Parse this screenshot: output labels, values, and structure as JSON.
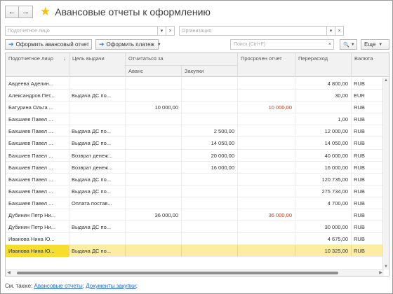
{
  "header": {
    "back": "←",
    "forward": "→",
    "title": "Авансовые отчеты к оформлению"
  },
  "filters": {
    "person_placeholder": "Подотчетное лицо",
    "org_placeholder": "Организация",
    "dd": "▾",
    "clear": "×"
  },
  "toolbar": {
    "create_report": "Оформить авансовый отчет",
    "create_payment": "Оформить платеж",
    "search_placeholder": "Поиск (Ctrl+F)",
    "search_clear": "×",
    "search_icon": "🔍",
    "more": "Еще"
  },
  "table": {
    "headers": {
      "person": "Подотчетное лицо",
      "sort": "↓",
      "purpose": "Цель выдачи",
      "report": "Отчитаться за",
      "advance": "Аванс",
      "purchases": "Закупки",
      "overdue": "Просрочен отчет",
      "overspend": "Перерасход",
      "currency": "Валюта"
    },
    "rows": [
      {
        "person": "Авдеева Аделин...",
        "purpose": "",
        "advance": "",
        "purchases": "",
        "overdue": "",
        "overspend": "4 800,00",
        "currency": "RUB"
      },
      {
        "person": "Александров Пет...",
        "purpose": "Выдача ДС по...",
        "advance": "",
        "purchases": "",
        "overdue": "",
        "overspend": "30,00",
        "currency": "EUR"
      },
      {
        "person": "Батурина Ольга ...",
        "purpose": "",
        "advance": "10 000,00",
        "purchases": "",
        "overdue": "10 000,00",
        "overspend": "",
        "currency": "RUB"
      },
      {
        "person": "Бахшиев Павел ...",
        "purpose": "",
        "advance": "",
        "purchases": "",
        "overdue": "",
        "overspend": "1,00",
        "currency": "RUB"
      },
      {
        "person": "Бахшиев Павел ...",
        "purpose": "Выдача ДС по...",
        "advance": "",
        "purchases": "2 500,00",
        "overdue": "",
        "overspend": "12 000,00",
        "currency": "RUB"
      },
      {
        "person": "Бахшиев Павел ...",
        "purpose": "Выдача ДС по...",
        "advance": "",
        "purchases": "14 050,00",
        "overdue": "",
        "overspend": "14 050,00",
        "currency": "RUB"
      },
      {
        "person": "Бахшиев Павел ...",
        "purpose": "Возврат денеж...",
        "advance": "",
        "purchases": "20 000,00",
        "overdue": "",
        "overspend": "40 000,00",
        "currency": "RUB"
      },
      {
        "person": "Бахшиев Павел ...",
        "purpose": "Возврат денеж...",
        "advance": "",
        "purchases": "16 000,00",
        "overdue": "",
        "overspend": "16 000,00",
        "currency": "RUB"
      },
      {
        "person": "Бахшиев Павел ...",
        "purpose": "Выдача ДС по...",
        "advance": "",
        "purchases": "",
        "overdue": "",
        "overspend": "120 735,00",
        "currency": "RUB"
      },
      {
        "person": "Бахшиев Павел ...",
        "purpose": "Выдача ДС по...",
        "advance": "",
        "purchases": "",
        "overdue": "",
        "overspend": "275 734,00",
        "currency": "RUB"
      },
      {
        "person": "Бахшиев Павел ...",
        "purpose": "Оплата постав...",
        "advance": "",
        "purchases": "",
        "overdue": "",
        "overspend": "4 700,00",
        "currency": "RUB"
      },
      {
        "person": "Дубинин Петр Ни...",
        "purpose": "",
        "advance": "36 000,00",
        "purchases": "",
        "overdue": "36 000,00",
        "overspend": "",
        "currency": "RUB"
      },
      {
        "person": "Дубинин Петр Ни...",
        "purpose": "Выдача ДС по...",
        "advance": "",
        "purchases": "",
        "overdue": "",
        "overspend": "30 000,00",
        "currency": "RUB"
      },
      {
        "person": "Иванова Нина Ю...",
        "purpose": "",
        "advance": "",
        "purchases": "",
        "overdue": "",
        "overspend": "4 675,00",
        "currency": "RUB"
      },
      {
        "person": "Иванова Нина Ю...",
        "purpose": "Выдача ДС по...",
        "advance": "",
        "purchases": "",
        "overdue": "",
        "overspend": "10 325,00",
        "currency": "RUB"
      }
    ]
  },
  "footer": {
    "prefix": "См. также:",
    "link1": "Авансовые отчеты",
    "sep": ";",
    "link2": "Документы закупки",
    "suffix": ";"
  },
  "colors": {
    "selected_row": "#fbeda1",
    "selected_cell": "#f7de2e",
    "overdue_text": "#c0392b",
    "link": "#2a6ab8",
    "star": "#f4c20d"
  }
}
